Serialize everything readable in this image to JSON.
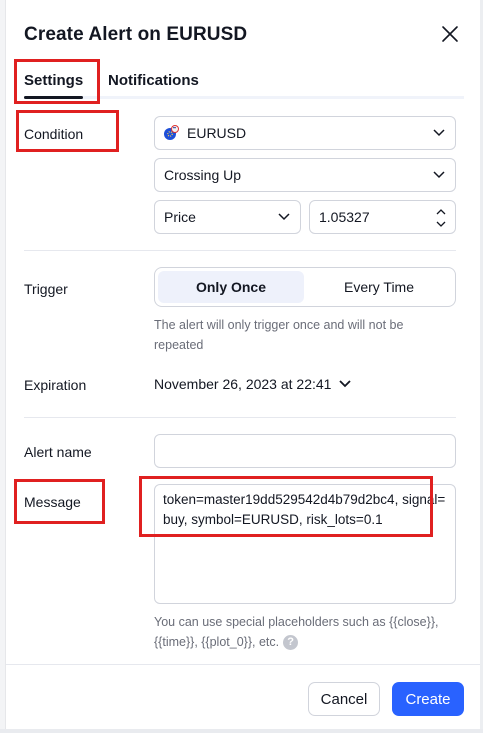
{
  "dialog": {
    "title": "Create Alert on EURUSD"
  },
  "tabs": [
    {
      "label": "Settings",
      "active": true
    },
    {
      "label": "Notifications",
      "active": false
    }
  ],
  "condition": {
    "label": "Condition",
    "symbol": "EURUSD",
    "operator": "Crossing Up",
    "source": "Price",
    "value": "1.05327"
  },
  "trigger": {
    "label": "Trigger",
    "options": [
      "Only Once",
      "Every Time"
    ],
    "selected": "Only Once",
    "hint": "The alert will only trigger once and will not be repeated"
  },
  "expiration": {
    "label": "Expiration",
    "value": "November 26, 2023 at 22:41"
  },
  "alert_name": {
    "label": "Alert name",
    "value": ""
  },
  "message": {
    "label": "Message",
    "value": "token=master19dd529542d4b79d2bc4, signal=buy, symbol=EURUSD, risk_lots=0.1",
    "hint": "You can use special placeholders such as {{close}}, {{time}}, {{plot_0}}, etc."
  },
  "footer": {
    "cancel_label": "Cancel",
    "create_label": "Create"
  },
  "colors": {
    "accent": "#2962ff",
    "highlight_box": "#e02020",
    "text": "#131722",
    "muted": "#6a6d78"
  },
  "icons": {
    "close": "close-icon",
    "chevron": "chevron-down-icon",
    "symbol": "symbol-flag-icon",
    "help": "help-icon"
  }
}
